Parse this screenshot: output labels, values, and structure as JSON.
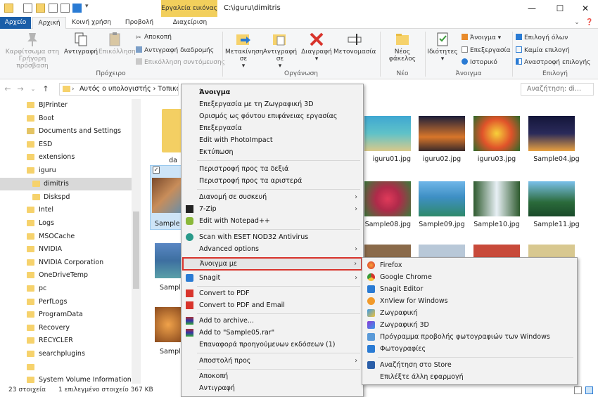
{
  "window": {
    "title": "C:\\iguru\\dimitris",
    "context_label": "Εργαλεία εικόνας",
    "minimize": "—",
    "maximize": "☐",
    "close": "✕"
  },
  "tabs": [
    {
      "label": "Αρχείο"
    },
    {
      "label": "Αρχική"
    },
    {
      "label": "Κοινή χρήση"
    },
    {
      "label": "Προβολή"
    },
    {
      "label": "Διαχείριση"
    }
  ],
  "ribbon": {
    "pin": "Καρφίτσωμα στη Γρήγορη πρόσβαση",
    "copy": "Αντιγραφή",
    "paste": "Επικόλληση",
    "cut": "Αποκοπή",
    "copy_path": "Αντιγραφή διαδρομής",
    "paste_shortcut": "Επικόλληση συντόμευσης",
    "clipboard_group": "Πρόχειρο",
    "move_to": "Μετακίνηση σε",
    "copy_to": "Αντιγραφή σε",
    "delete": "Διαγραφή",
    "rename": "Μετονομασία",
    "organize_group": "Οργάνωση",
    "new_folder": "Νέος φάκελος",
    "new_group": "Νέο",
    "properties": "Ιδιότητες",
    "open": "Άνοιγμα",
    "edit": "Επεξεργασία",
    "history": "Ιστορικό",
    "open_group": "Άνοιγμα",
    "select_all": "Επιλογή όλων",
    "select_none": "Καμία επιλογή",
    "invert_selection": "Αναστροφή επιλογής",
    "select_group": "Επιλογή"
  },
  "address": {
    "path": "Αυτός ο υπολογιστής  ›  Τοπικό",
    "search_placeholder": "Αναζήτηση: di..."
  },
  "tree": [
    "BJPrinter",
    "Boot",
    "Documents and Settings",
    "ESD",
    "extensions",
    "iguru",
    "dimitris",
    "Diskspd",
    "Intel",
    "Logs",
    "MSOCache",
    "NVIDIA",
    "NVIDIA Corporation",
    "OneDriveTemp",
    "pc",
    "PerfLogs",
    "ProgramData",
    "Recovery",
    "RECYCLER",
    "searchplugins",
    "",
    "System Volume Information"
  ],
  "files": {
    "f0": "da",
    "f1": "Sample",
    "f2": "Sample",
    "f3": "Sample",
    "r1": [
      "iguru01.jpg",
      "iguru02.jpg",
      "iguru03.jpg",
      "Sample04.jpg"
    ],
    "r2": [
      "Sample08.jpg",
      "Sample09.jpg",
      "Sample10.jpg",
      "Sample11.jpg"
    ]
  },
  "status": {
    "count": "23 στοιχεία",
    "selected": "1 επιλεγμένο στοιχείο  367 KB"
  },
  "context_menu": {
    "open": "Άνοιγμα",
    "edit_paint3d": "Επεξεργασία με τη Ζωγραφική 3D",
    "set_bg": "Ορισμός ως φόντου επιφάνειας εργασίας",
    "edit": "Επεξεργασία",
    "edit_photoimpact": "Edit with PhotoImpact",
    "print": "Εκτύπωση",
    "rotate_right": "Περιστροφή προς τα δεξιά",
    "rotate_left": "Περιστροφή προς τα αριστερά",
    "cast": "Διανομή σε συσκευή",
    "zip": "7-Zip",
    "notepad": "Edit with Notepad++",
    "eset": "Scan with ESET NOD32 Antivirus",
    "advanced": "Advanced options",
    "open_with": "Άνοιγμα με",
    "snagit": "Snagit",
    "pdf": "Convert to PDF",
    "pdf_email": "Convert to PDF and Email",
    "add_archive": "Add to archive...",
    "add_rar": "Add to \"Sample05.rar\"",
    "restore": "Επαναφορά προηγούμενων εκδόσεων (1)",
    "send_to": "Αποστολή προς",
    "cut": "Αποκοπή",
    "copy": "Αντιγραφή"
  },
  "submenu": [
    "Firefox",
    "Google Chrome",
    "Snagit Editor",
    "XnView for Windows",
    "Ζωγραφική",
    "Ζωγραφική 3D",
    "Πρόγραμμα προβολής φωτογραφιών των Windows",
    "Φωτογραφίες",
    "Αναζήτηση στο Store",
    "Επιλέξτε άλλη εφαρμογή"
  ],
  "colors": {
    "accent": "#1a5ea8",
    "highlight_border": "#d8342c",
    "context_tab": "#f2cf5c"
  }
}
